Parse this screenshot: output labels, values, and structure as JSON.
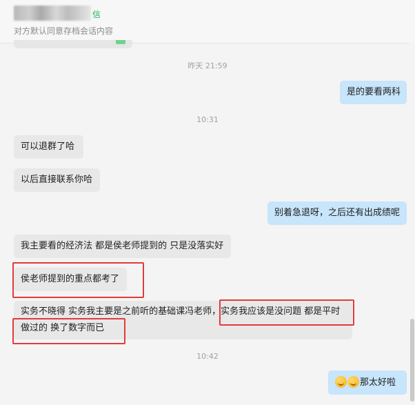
{
  "header": {
    "name_tag": "信",
    "subtitle": "对方默认同意存档会话内容"
  },
  "messages": {
    "t1": "昨天 21:59",
    "m1": "是的要看两科",
    "t2": "10:31",
    "m2": "可以退群了哈",
    "m3": "以后直接联系你哈",
    "m4": "别着急退呀，之后还有出成绩呢",
    "m5": "我主要看的经济法 都是侯老师提到的 只是没落实好",
    "m6": "侯老师提到的重点都考了",
    "m7_line1": "实务不晓得 实务我主要是之前听的基础课冯老师，实务我应该是没问题 都是平时",
    "m7_line2": "做过的 换了数字而已",
    "t3": "10:42",
    "m8": "那太好啦"
  },
  "emojis": [
    "smile-emoji",
    "smile-emoji"
  ]
}
